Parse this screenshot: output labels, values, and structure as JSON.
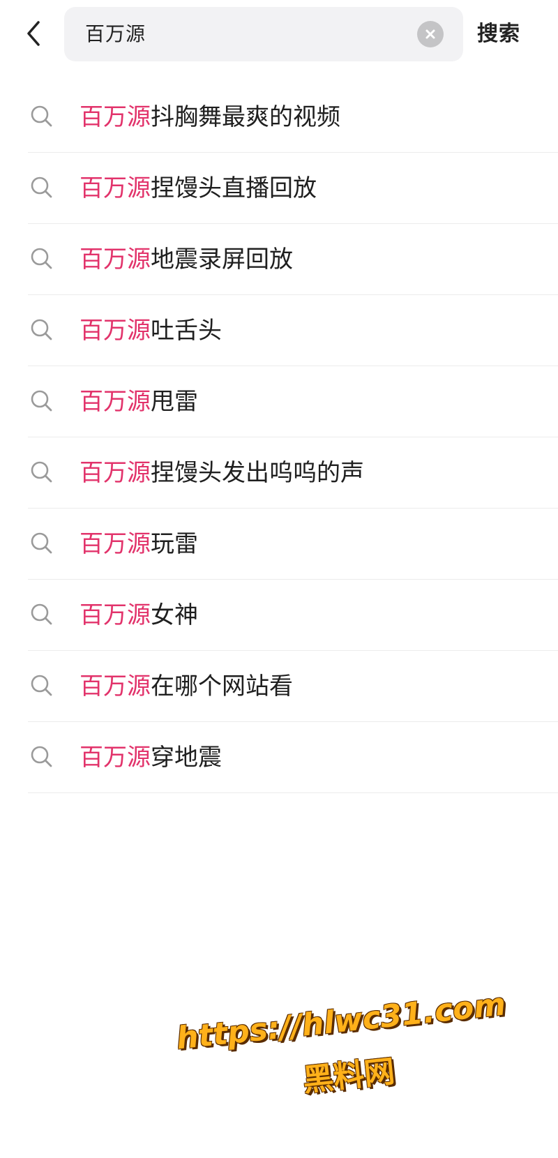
{
  "header": {
    "back_icon": "chevron-left-icon",
    "query": "百万源",
    "clear_icon": "clear-circle-icon",
    "search_label": "搜索"
  },
  "suggestions": {
    "highlight_color": "#e2336b",
    "icon": "search-icon",
    "items": [
      {
        "highlight": "百万源",
        "rest": "抖胸舞最爽的视频"
      },
      {
        "highlight": "百万源",
        "rest": "捏馒头直播回放"
      },
      {
        "highlight": "百万源",
        "rest": "地震录屏回放"
      },
      {
        "highlight": "百万源",
        "rest": "吐舌头"
      },
      {
        "highlight": "百万源",
        "rest": "甩雷"
      },
      {
        "highlight": "百万源",
        "rest": "捏馒头发出呜呜的声"
      },
      {
        "highlight": "百万源",
        "rest": "玩雷"
      },
      {
        "highlight": "百万源",
        "rest": "女神"
      },
      {
        "highlight": "百万源",
        "rest": "在哪个网站看"
      },
      {
        "highlight": "百万源",
        "rest": "穿地震"
      }
    ]
  },
  "watermark": {
    "url": "https://hlwc31.com",
    "name": "黑料网",
    "color": "#ffb11a"
  }
}
